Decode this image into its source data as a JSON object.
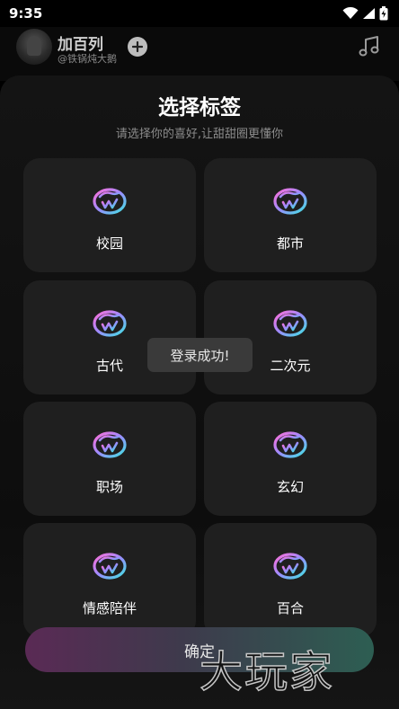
{
  "status_bar": {
    "time": "9:35",
    "icons": [
      "wifi-icon",
      "signal-icon",
      "battery-icon"
    ]
  },
  "header": {
    "author_name": "加百列",
    "author_handle": "@铁锅炖大鹅",
    "follow_icon": "plus-icon",
    "music_icon": "music-note-icon"
  },
  "dialog": {
    "title": "选择标签",
    "subtitle": "请选择你的喜好,让甜甜圈更懂你",
    "tags": [
      {
        "label": "校园",
        "icon": "donut-icon"
      },
      {
        "label": "都市",
        "icon": "donut-icon"
      },
      {
        "label": "古代",
        "icon": "donut-icon"
      },
      {
        "label": "二次元",
        "icon": "donut-icon"
      },
      {
        "label": "职场",
        "icon": "donut-icon"
      },
      {
        "label": "玄幻",
        "icon": "donut-icon"
      },
      {
        "label": "情感陪伴",
        "icon": "donut-icon"
      },
      {
        "label": "百合",
        "icon": "donut-icon"
      }
    ],
    "confirm_label": "确定"
  },
  "toast": {
    "text": "登录成功!"
  },
  "watermark": {
    "text": "大玩家"
  },
  "colors": {
    "card_bg": "#1f1f1f",
    "sheet_bg": "#141414",
    "icon_gradient_start": "#ff6fd8",
    "icon_gradient_end": "#3ee3e0"
  }
}
